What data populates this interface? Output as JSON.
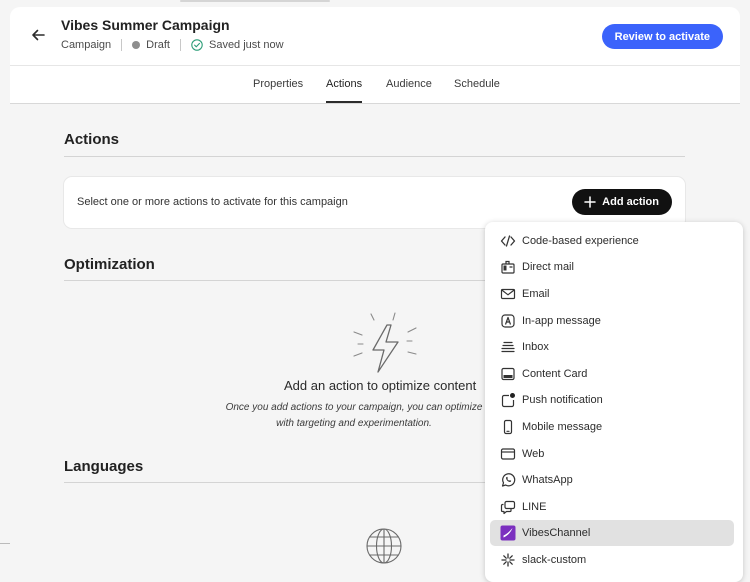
{
  "header": {
    "title": "Vibes Summer Campaign",
    "type": "Campaign",
    "status": "Draft",
    "saved": "Saved just now",
    "review_label": "Review to activate",
    "colors": {
      "primary": "#3b63fb",
      "status_dot": "#8e8e8e",
      "saved_check": "#2d9d78"
    }
  },
  "tabs": [
    {
      "label": "Properties",
      "active": false
    },
    {
      "label": "Actions",
      "active": true
    },
    {
      "label": "Audience",
      "active": false
    },
    {
      "label": "Schedule",
      "active": false
    }
  ],
  "actions": {
    "heading": "Actions",
    "prompt": "Select one or more actions to activate for this campaign",
    "add_label": "Add action"
  },
  "optimization": {
    "heading": "Optimization",
    "empty_title": "Add an action to optimize content",
    "empty_desc": "Once you add actions to your campaign, you can optimize with targeting and experimentation."
  },
  "languages": {
    "heading": "Languages"
  },
  "menu": {
    "items": [
      {
        "label": "Code-based experience",
        "icon": "code-icon"
      },
      {
        "label": "Direct mail",
        "icon": "direct-mail-icon"
      },
      {
        "label": "Email",
        "icon": "email-icon"
      },
      {
        "label": "In-app message",
        "icon": "in-app-icon"
      },
      {
        "label": "Inbox",
        "icon": "inbox-icon"
      },
      {
        "label": "Content Card",
        "icon": "content-card-icon"
      },
      {
        "label": "Push notification",
        "icon": "push-icon"
      },
      {
        "label": "Mobile message",
        "icon": "mobile-icon"
      },
      {
        "label": "Web",
        "icon": "web-icon"
      },
      {
        "label": "WhatsApp",
        "icon": "whatsapp-icon"
      },
      {
        "label": "LINE",
        "icon": "line-icon"
      },
      {
        "label": "VibesChannel",
        "icon": "vibes-logo-icon",
        "hovered": true
      },
      {
        "label": "slack-custom",
        "icon": "slack-icon"
      }
    ]
  }
}
